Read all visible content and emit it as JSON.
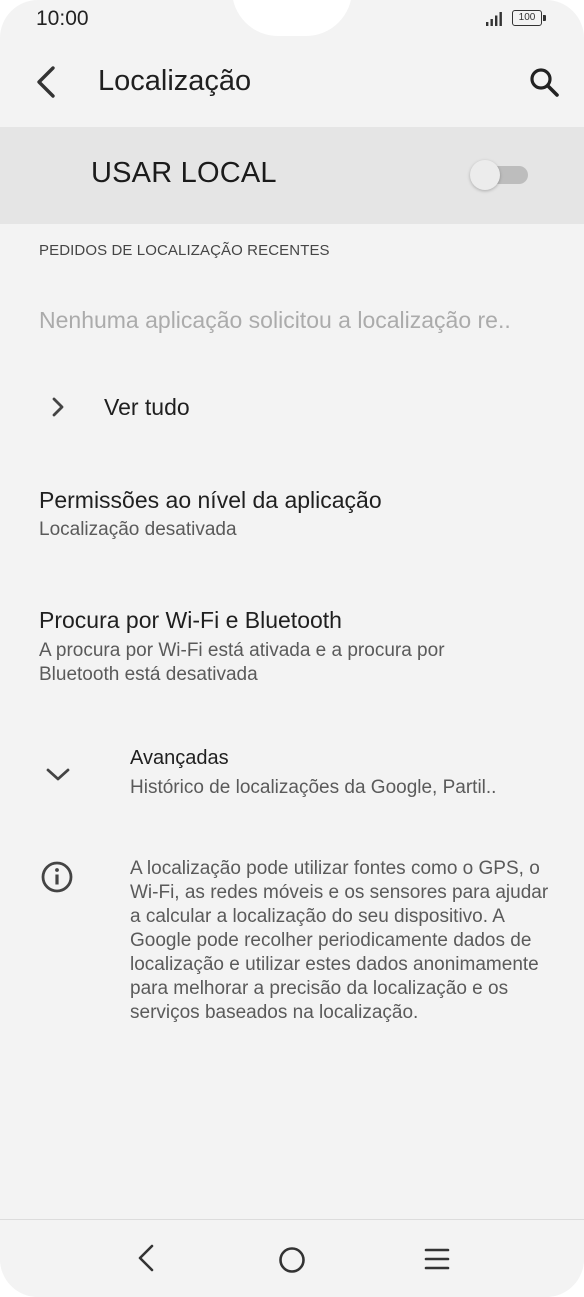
{
  "status_bar": {
    "time": "10:00",
    "battery": "100",
    "icons": [
      "signal-icon",
      "battery-icon"
    ]
  },
  "app_bar": {
    "title": "Localização",
    "icons": [
      "back-arrow-icon",
      "search-icon"
    ]
  },
  "master_switch": {
    "label": "USAR LOCAL",
    "state": "off"
  },
  "recent_requests": {
    "header": "PEDIDOS DE LOCALIZAÇÃO RECENTES",
    "empty_message": "Nenhuma aplicação solicitou a localização re..",
    "see_all": "Ver tudo"
  },
  "app_permissions": {
    "title": "Permissões ao nível da aplicação",
    "summary": "Localização desativada"
  },
  "scanning": {
    "title": "Procura por Wi-Fi e Bluetooth",
    "summary": "A procura por Wi-Fi está ativada e a procura por Bluetooth está desativada"
  },
  "advanced": {
    "title": "Avançadas",
    "summary": "Histórico de localizações da Google, Partil.."
  },
  "info": {
    "text": "A localização pode utilizar fontes como o GPS, o Wi-Fi, as redes móveis e os sensores para ajudar a calcular a localização do seu dispositivo. A Google pode recolher periodicamente dados de localização e utilizar estes dados anonimamente para melhorar a precisão da localização e os serviços baseados na localização."
  },
  "nav_bar": {
    "icons": [
      "nav-back-icon",
      "nav-home-icon",
      "nav-menu-icon"
    ]
  },
  "colors": {
    "background": "#f3f3f3",
    "master_background": "#e5e5e5",
    "secondary_text": "#5a5a5a",
    "disabled_text": "#ababab"
  }
}
